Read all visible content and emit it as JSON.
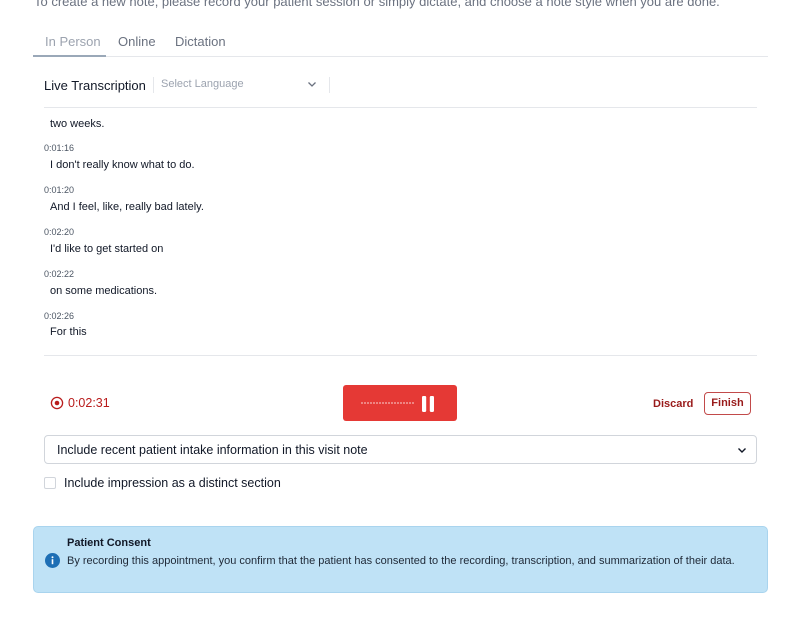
{
  "intro_text": "To create a new note, please record your patient session or simply dictate, and choose a note style when you are done.",
  "tabs": [
    {
      "label": "In Person",
      "active": true
    },
    {
      "label": "Online",
      "active": false
    },
    {
      "label": "Dictation",
      "active": false
    }
  ],
  "transcription": {
    "title": "Live Transcription",
    "language_placeholder": "Select Language",
    "entries": [
      {
        "time": "",
        "text": "two weeks."
      },
      {
        "time": "0:01:16",
        "text": "I don't really know what to do."
      },
      {
        "time": "0:01:20",
        "text": "And I feel, like, really bad lately."
      },
      {
        "time": "0:02:20",
        "text": "I'd like to get started on"
      },
      {
        "time": "0:02:22",
        "text": "on some medications."
      },
      {
        "time": "0:02:26",
        "text": "For this"
      }
    ]
  },
  "recording": {
    "elapsed": "0:02:31",
    "discard_label": "Discard",
    "finish_label": "Finish",
    "button_color": "#e53935"
  },
  "intake": {
    "selected": "Include recent patient intake information in this visit note"
  },
  "impression": {
    "label": "Include impression as a distinct section",
    "checked": false
  },
  "consent": {
    "title": "Patient Consent",
    "text": "By recording this appointment, you confirm that the patient has consented to the recording, transcription, and summarization of their data.",
    "background": "#bfe2f6",
    "icon_color": "#1e6fb5"
  },
  "icons": {
    "record": "record-icon",
    "pause": "pause-icon",
    "chevron": "chevron-down-icon",
    "info": "info-icon"
  }
}
